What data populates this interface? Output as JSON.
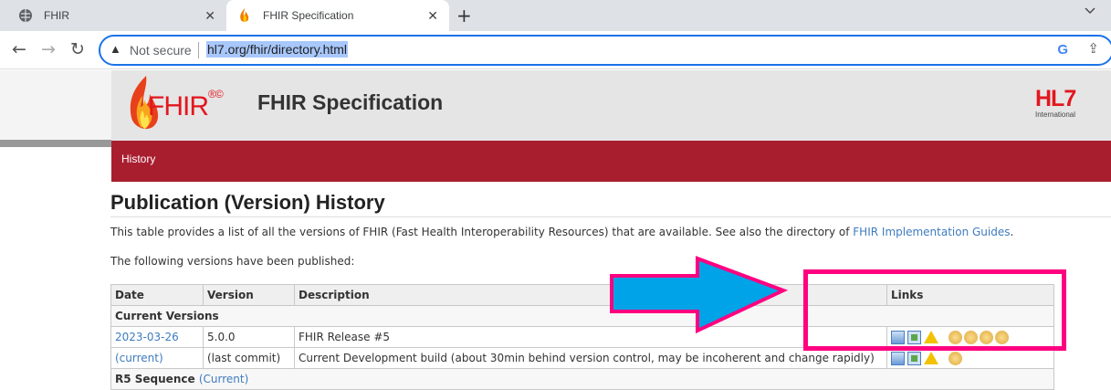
{
  "browser": {
    "tabs": [
      {
        "title": "FHIR",
        "icon": "globe-icon"
      },
      {
        "title": "FHIR Specification",
        "icon": "fhir-flame-icon",
        "active": true
      }
    ],
    "new_tab": "+",
    "tab_menu": "⌄",
    "security_label": "Not secure",
    "url": "hl7.org/fhir/directory.html"
  },
  "header": {
    "logo_text": "FHIR",
    "logo_marks": "®©",
    "title": "FHIR Specification",
    "hl7_logo": "HL7",
    "hl7_sub": "International"
  },
  "nav": {
    "items": [
      {
        "label": "History"
      }
    ]
  },
  "page": {
    "heading": "Publication (Version) History",
    "intro_prefix": "This table provides a list of all the versions of FHIR (Fast Health Interoperability Resources) that are available. See also the directory of ",
    "intro_link": "FHIR Implementation Guides",
    "intro_suffix": ".",
    "published_label": "The following versions have been published:"
  },
  "table": {
    "columns": [
      "Date",
      "Version",
      "Description",
      "Links"
    ],
    "section_current": "Current Versions",
    "rows": [
      {
        "date": "2023-03-26",
        "version": "5.0.0",
        "description": "FHIR Release #5",
        "packages": 4
      },
      {
        "date": "(current)",
        "version": "(last commit)",
        "description": "Current Development build (about 30min behind version control, may be incoherent and change rapidly)",
        "packages": 1
      }
    ],
    "section_r5": "R5 Sequence",
    "section_r5_link": "(Current)"
  },
  "colors": {
    "nav_red": "#a91e2f",
    "annotation_pink": "#ff0080",
    "annotation_blue": "#00a2e8",
    "link": "#3e7cbf"
  }
}
